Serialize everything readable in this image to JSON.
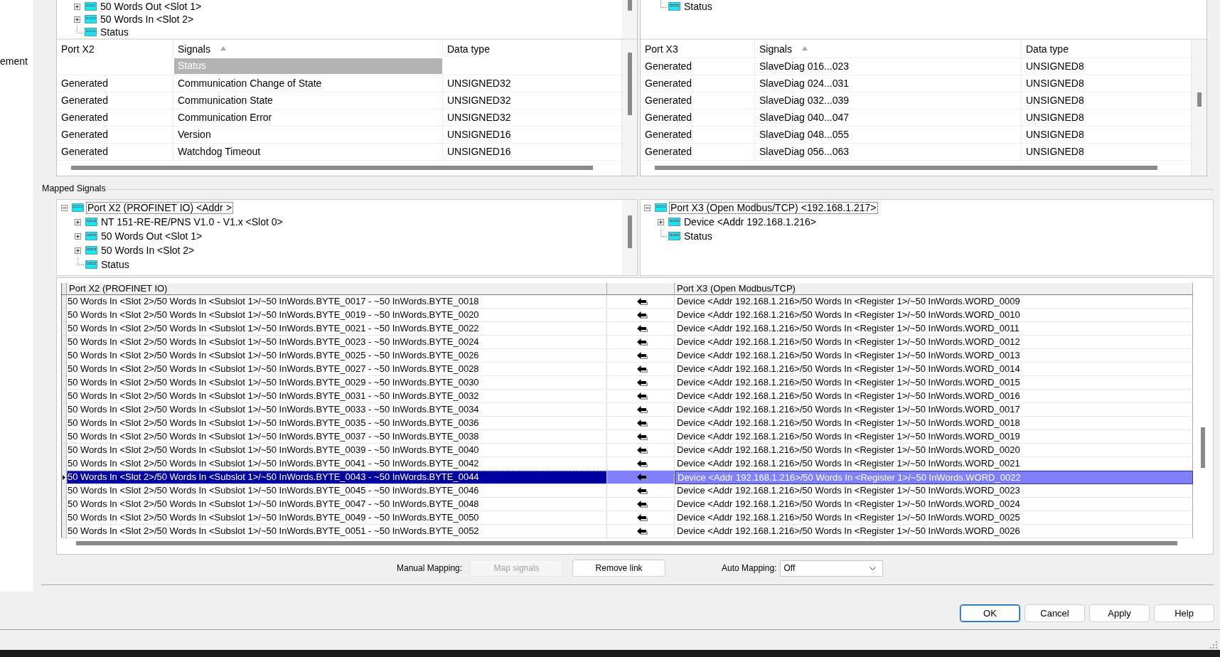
{
  "side_panel": {
    "text": "ement"
  },
  "device_panels": [
    {
      "tree": [
        {
          "label": "50 Words Out <Slot 1>",
          "expanded": false
        },
        {
          "label": "50 Words In <Slot 2>",
          "expanded": false
        },
        {
          "label": "Status"
        }
      ],
      "table": {
        "columns": [
          {
            "label": "Port X2",
            "sorted": false
          },
          {
            "label": "Signals",
            "sorted": true
          },
          {
            "label": "Data type",
            "sorted": false
          }
        ],
        "group_row": "Status",
        "rows": [
          [
            "Generated",
            "Communication Change of State",
            "UNSIGNED32"
          ],
          [
            "Generated",
            "Communication State",
            "UNSIGNED32"
          ],
          [
            "Generated",
            "Communication Error",
            "UNSIGNED32"
          ],
          [
            "Generated",
            "Version",
            "UNSIGNED16"
          ],
          [
            "Generated",
            "Watchdog Timeout",
            "UNSIGNED16"
          ]
        ]
      }
    },
    {
      "tree": [
        {
          "label": "Status"
        }
      ],
      "table": {
        "columns": [
          {
            "label": "Port X3",
            "sorted": false
          },
          {
            "label": "Signals",
            "sorted": true
          },
          {
            "label": "Data type",
            "sorted": false
          }
        ],
        "rows": [
          [
            "Generated",
            "SlaveDiag 016...023",
            "UNSIGNED8"
          ],
          [
            "Generated",
            "SlaveDiag 024...031",
            "UNSIGNED8"
          ],
          [
            "Generated",
            "SlaveDiag 032...039",
            "UNSIGNED8"
          ],
          [
            "Generated",
            "SlaveDiag 040...047",
            "UNSIGNED8"
          ],
          [
            "Generated",
            "SlaveDiag 048...055",
            "UNSIGNED8"
          ],
          [
            "Generated",
            "SlaveDiag 056...063",
            "UNSIGNED8"
          ]
        ]
      }
    }
  ],
  "mapped_signals": {
    "title": "Mapped Signals",
    "trees": [
      {
        "label": "Port X2 (PROFINET IO) <Addr >",
        "expanded": true,
        "selected": true,
        "children": [
          {
            "label": "NT 151-RE-RE/PNS V1.0 - V1.x <Slot 0>",
            "expanded": false,
            "selected": false
          },
          {
            "label": "50 Words Out <Slot 1>",
            "expanded": false,
            "selected": false
          },
          {
            "label": "50 Words In <Slot 2>",
            "expanded": false,
            "selected": false
          },
          {
            "label": "Status",
            "selected": false
          }
        ]
      },
      {
        "label": "Port X3 (Open Modbus/TCP) <192.168.1.217>",
        "expanded": true,
        "selected": true,
        "children": [
          {
            "label": "Device <Addr 192.168.1.216>",
            "expanded": false,
            "selected": false
          },
          {
            "label": "Status",
            "selected": false
          }
        ]
      }
    ],
    "mapping_table": {
      "columns": [
        "Port X2 (PROFINET IO)",
        "Port X3 (Open Modbus/TCP)"
      ],
      "rows": [
        {
          "source": "50 Words In <Slot 2>/50 Words In <Subslot 1>/~50 InWords.BYTE_0017 - ~50 InWords.BYTE_0018",
          "target": "Device <Addr 192.168.1.216>/50 Words In <Register 1>/~50 InWords.WORD_0009",
          "selected": false
        },
        {
          "source": "50 Words In <Slot 2>/50 Words In <Subslot 1>/~50 InWords.BYTE_0019 - ~50 InWords.BYTE_0020",
          "target": "Device <Addr 192.168.1.216>/50 Words In <Register 1>/~50 InWords.WORD_0010",
          "selected": false
        },
        {
          "source": "50 Words In <Slot 2>/50 Words In <Subslot 1>/~50 InWords.BYTE_0021 - ~50 InWords.BYTE_0022",
          "target": "Device <Addr 192.168.1.216>/50 Words In <Register 1>/~50 InWords.WORD_0011",
          "selected": false
        },
        {
          "source": "50 Words In <Slot 2>/50 Words In <Subslot 1>/~50 InWords.BYTE_0023 - ~50 InWords.BYTE_0024",
          "target": "Device <Addr 192.168.1.216>/50 Words In <Register 1>/~50 InWords.WORD_0012",
          "selected": false
        },
        {
          "source": "50 Words In <Slot 2>/50 Words In <Subslot 1>/~50 InWords.BYTE_0025 - ~50 InWords.BYTE_0026",
          "target": "Device <Addr 192.168.1.216>/50 Words In <Register 1>/~50 InWords.WORD_0013",
          "selected": false
        },
        {
          "source": "50 Words In <Slot 2>/50 Words In <Subslot 1>/~50 InWords.BYTE_0027 - ~50 InWords.BYTE_0028",
          "target": "Device <Addr 192.168.1.216>/50 Words In <Register 1>/~50 InWords.WORD_0014",
          "selected": false
        },
        {
          "source": "50 Words In <Slot 2>/50 Words In <Subslot 1>/~50 InWords.BYTE_0029 - ~50 InWords.BYTE_0030",
          "target": "Device <Addr 192.168.1.216>/50 Words In <Register 1>/~50 InWords.WORD_0015",
          "selected": false
        },
        {
          "source": "50 Words In <Slot 2>/50 Words In <Subslot 1>/~50 InWords.BYTE_0031 - ~50 InWords.BYTE_0032",
          "target": "Device <Addr 192.168.1.216>/50 Words In <Register 1>/~50 InWords.WORD_0016",
          "selected": false
        },
        {
          "source": "50 Words In <Slot 2>/50 Words In <Subslot 1>/~50 InWords.BYTE_0033 - ~50 InWords.BYTE_0034",
          "target": "Device <Addr 192.168.1.216>/50 Words In <Register 1>/~50 InWords.WORD_0017",
          "selected": false
        },
        {
          "source": "50 Words In <Slot 2>/50 Words In <Subslot 1>/~50 InWords.BYTE_0035 - ~50 InWords.BYTE_0036",
          "target": "Device <Addr 192.168.1.216>/50 Words In <Register 1>/~50 InWords.WORD_0018",
          "selected": false
        },
        {
          "source": "50 Words In <Slot 2>/50 Words In <Subslot 1>/~50 InWords.BYTE_0037 - ~50 InWords.BYTE_0038",
          "target": "Device <Addr 192.168.1.216>/50 Words In <Register 1>/~50 InWords.WORD_0019",
          "selected": false
        },
        {
          "source": "50 Words In <Slot 2>/50 Words In <Subslot 1>/~50 InWords.BYTE_0039 - ~50 InWords.BYTE_0040",
          "target": "Device <Addr 192.168.1.216>/50 Words In <Register 1>/~50 InWords.WORD_0020",
          "selected": false
        },
        {
          "source": "50 Words In <Slot 2>/50 Words In <Subslot 1>/~50 InWords.BYTE_0041 - ~50 InWords.BYTE_0042",
          "target": "Device <Addr 192.168.1.216>/50 Words In <Register 1>/~50 InWords.WORD_0021",
          "selected": false
        },
        {
          "source": "50 Words In <Slot 2>/50 Words In <Subslot 1>/~50 InWords.BYTE_0043 - ~50 InWords.BYTE_0044",
          "target": "Device <Addr 192.168.1.216>/50 Words In <Register 1>/~50 InWords.WORD_0022",
          "selected": true
        },
        {
          "source": "50 Words In <Slot 2>/50 Words In <Subslot 1>/~50 InWords.BYTE_0045 - ~50 InWords.BYTE_0046",
          "target": "Device <Addr 192.168.1.216>/50 Words In <Register 1>/~50 InWords.WORD_0023",
          "selected": false
        },
        {
          "source": "50 Words In <Slot 2>/50 Words In <Subslot 1>/~50 InWords.BYTE_0047 - ~50 InWords.BYTE_0048",
          "target": "Device <Addr 192.168.1.216>/50 Words In <Register 1>/~50 InWords.WORD_0024",
          "selected": false
        },
        {
          "source": "50 Words In <Slot 2>/50 Words In <Subslot 1>/~50 InWords.BYTE_0049 - ~50 InWords.BYTE_0050",
          "target": "Device <Addr 192.168.1.216>/50 Words In <Register 1>/~50 InWords.WORD_0025",
          "selected": false
        },
        {
          "source": "50 Words In <Slot 2>/50 Words In <Subslot 1>/~50 InWords.BYTE_0051 - ~50 InWords.BYTE_0052",
          "target": "Device <Addr 192.168.1.216>/50 Words In <Register 1>/~50 InWords.WORD_0026",
          "selected": false
        }
      ]
    }
  },
  "mapping_controls": {
    "manual_label": "Manual Mapping:",
    "buttons": [
      {
        "label": "Map signals",
        "disabled": true
      },
      {
        "label": "Remove link",
        "disabled": false
      }
    ],
    "auto_label": "Auto Mapping:",
    "auto_value": "Off"
  },
  "dialog_buttons": [
    {
      "label": "OK",
      "default": true
    },
    {
      "label": "Cancel",
      "default": false
    },
    {
      "label": "Apply",
      "default": false
    },
    {
      "label": "Help",
      "default": false
    }
  ]
}
